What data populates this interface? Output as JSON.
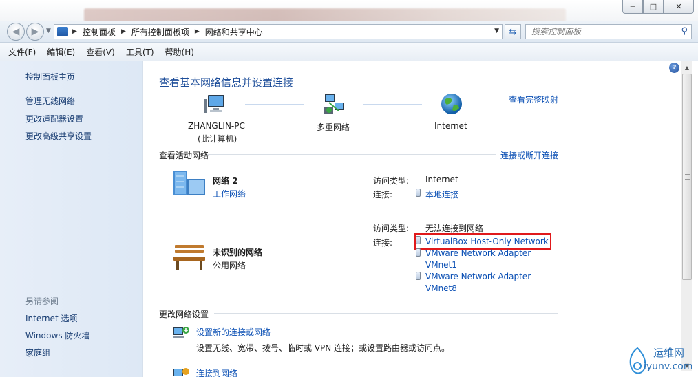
{
  "window": {
    "controls": {
      "minimize": "─",
      "maximize": "□",
      "close": "✕"
    }
  },
  "address_bar": {
    "back": "◀",
    "forward": "▶",
    "breadcrumbs": [
      "控制面板",
      "所有控制面板项",
      "网络和共享中心"
    ],
    "search_placeholder": "搜索控制面板"
  },
  "menu": [
    "文件(F)",
    "编辑(E)",
    "查看(V)",
    "工具(T)",
    "帮助(H)"
  ],
  "sidebar": {
    "home": "控制面板主页",
    "links": [
      "管理无线网络",
      "更改适配器设置",
      "更改高级共享设置"
    ],
    "see_also_heading": "另请参阅",
    "see_also": [
      "Internet 选项",
      "Windows 防火墙",
      "家庭组"
    ]
  },
  "main": {
    "title": "查看基本网络信息并设置连接",
    "view_full_map": "查看完整映射",
    "map": {
      "computer_name": "ZHANGLIN-PC",
      "computer_sub": "(此计算机)",
      "middle": "多重网络",
      "internet": "Internet"
    },
    "active_networks_heading": "查看活动网络",
    "connect_disconnect": "连接或断开连接",
    "networks": [
      {
        "name": "网络  2",
        "type": "工作网络",
        "access_label": "访问类型:",
        "access_value": "Internet",
        "conn_label": "连接:",
        "connections": [
          "本地连接"
        ]
      },
      {
        "name": "未识别的网络",
        "type": "公用网络",
        "access_label": "访问类型:",
        "access_value": "无法连接到网络",
        "conn_label": "连接:",
        "connections": [
          "VirtualBox Host-Only Network",
          "VMware Network Adapter",
          "VMnet1",
          "VMware Network Adapter",
          "VMnet8"
        ]
      }
    ],
    "change_settings_heading": "更改网络设置",
    "tasks": [
      {
        "title": "设置新的连接或网络",
        "desc": "设置无线、宽带、拨号、临时或 VPN 连接；或设置路由器或访问点。"
      },
      {
        "title": "连接到网络"
      }
    ]
  },
  "watermark": {
    "cn": "运维网",
    "url": "iyunv.com"
  }
}
